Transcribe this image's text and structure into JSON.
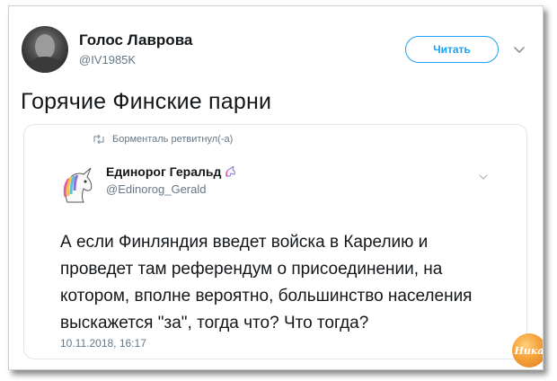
{
  "tweet": {
    "author_name": "Голос Лаврова",
    "author_handle": "@IV1985K",
    "follow_label": "Читать",
    "text": "Горячие Финские парни"
  },
  "quote": {
    "retweet_line": "Борменталь ретвитнул(-а)",
    "author_name": "Единорог Геральд",
    "author_handle": "@Edinorog_Gerald",
    "text": "А если Финляндия введет войска в Карелию и проведет там референдум о присоединении, на котором, вполне вероятно, большинство населения выскажется \"за\", тогда что? Что тогда?",
    "timestamp": "10.11.2018, 16:17"
  },
  "watermark": {
    "text": "Ника"
  },
  "colors": {
    "accent": "#1da1f2",
    "secondary_text": "#657786",
    "border": "#e1e8ed"
  },
  "icons": {
    "retweet": "retweet-icon",
    "caret": "chevron-down-icon",
    "unicorn": "unicorn-icon"
  }
}
